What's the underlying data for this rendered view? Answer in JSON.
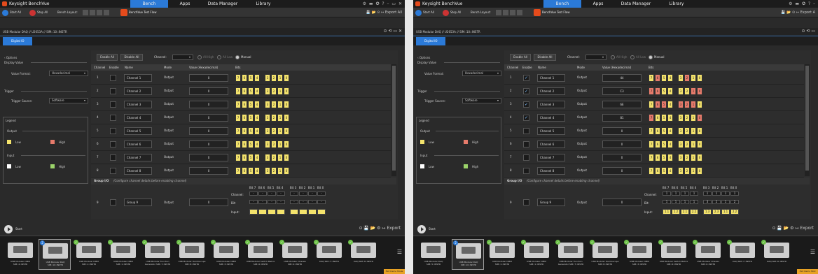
{
  "panels": [
    {
      "app_title": "Keysight BenchVue",
      "menus": [
        "Bench",
        "Apps",
        "Data Manager",
        "Library"
      ],
      "title_icons": "⚙ ▬ ✪ ? – ▭ ✕",
      "toolbar": {
        "start_all": "Start All",
        "stop_all": "Stop All",
        "bench_layout": "Bench Layout:",
        "test_flow": "BenchVue Test Flow",
        "right": "💾 📂 ⊙ ↦ Export All"
      },
      "breadcrumb": "USB Modular DAQ // U2653A // SIM::10::INSTR",
      "inst_icons": "⊙ ⟲ ▭ ✕",
      "tab_label": "Digital IO",
      "sidebar": {
        "options": "‹ Options",
        "display_value": "Display Value",
        "value_format_label": "Value Format:",
        "value_format": "Hexadecimal",
        "trigger": "Trigger",
        "trigger_source_label": "Trigger Source:",
        "trigger_source": "Software",
        "legend": "Legend",
        "output": "Output",
        "input": "Input",
        "low": "Low",
        "high": "High"
      },
      "controls": {
        "enable_all": "Enable All",
        "disable_all": "Disable All",
        "channel": "Channel:",
        "all_high": "All High",
        "all_low": "All Low",
        "manual": "Manual"
      },
      "headers": [
        "Channel",
        "Enable",
        "Name",
        "Mode",
        "Value (Hexadecimal)",
        "Bits"
      ],
      "rows": [
        {
          "num": "1",
          "enabled": "",
          "name": "Channel 1",
          "mode": "Output",
          "value": "0",
          "high": [
            0,
            0,
            0,
            0,
            0,
            0,
            0,
            0
          ]
        },
        {
          "num": "2",
          "enabled": "",
          "name": "Channel 2",
          "mode": "Output",
          "value": "0",
          "high": [
            0,
            0,
            0,
            0,
            0,
            0,
            0,
            0
          ]
        },
        {
          "num": "3",
          "enabled": "",
          "name": "Channel 3",
          "mode": "Output",
          "value": "0",
          "high": [
            0,
            0,
            0,
            0,
            0,
            0,
            0,
            0
          ]
        },
        {
          "num": "4",
          "enabled": "",
          "name": "Channel 4",
          "mode": "Output",
          "value": "0",
          "high": [
            0,
            0,
            0,
            0,
            0,
            0,
            0,
            0
          ]
        },
        {
          "num": "5",
          "enabled": "",
          "name": "Channel 5",
          "mode": "Output",
          "value": "0",
          "high": [
            0,
            0,
            0,
            0,
            0,
            0,
            0,
            0
          ]
        },
        {
          "num": "6",
          "enabled": "",
          "name": "Channel 6",
          "mode": "Output",
          "value": "0",
          "high": [
            0,
            0,
            0,
            0,
            0,
            0,
            0,
            0
          ]
        },
        {
          "num": "7",
          "enabled": "",
          "name": "Channel 7",
          "mode": "Output",
          "value": "0",
          "high": [
            0,
            0,
            0,
            0,
            0,
            0,
            0,
            0
          ]
        },
        {
          "num": "8",
          "enabled": "",
          "name": "Channel 8",
          "mode": "Output",
          "value": "0",
          "high": [
            0,
            0,
            0,
            0,
            0,
            0,
            0,
            0
          ]
        }
      ],
      "bit_digits": [
        "7",
        "6",
        "5",
        "4",
        "3",
        "2",
        "1",
        "0"
      ],
      "group": {
        "title": "Group I/O",
        "note": "(Configure channel details before enabling channel)",
        "bit_labels": [
          "Bit 7",
          "Bit 6",
          "Bit 5",
          "Bit 4",
          "Bit 3",
          "Bit 2",
          "Bit 1",
          "Bit 0"
        ],
        "row_num": "9",
        "name": "Group 9",
        "mode": "Output",
        "value": "0",
        "channel_label": "Channel:",
        "bit_label": "Bit:",
        "input_label": "Input:",
        "channel_vals": [
          "-",
          "-",
          "-",
          "-",
          "-",
          "-",
          "-",
          "-"
        ],
        "bit_vals": [
          "-",
          "-",
          "-",
          "-",
          "-",
          "-",
          "-",
          "-"
        ],
        "input_vals": [
          "",
          "",
          "",
          "",
          "",
          "",
          "",
          ""
        ]
      },
      "start": "Start",
      "start_icons": "⊙ 💾 📂 ⚙ ↦ Export",
      "devices": [
        {
          "label": "USB Modular DMM SIM::4::INSTR",
          "badge": ""
        },
        {
          "label": "USB Modular DAQ SIM::10::INSTR",
          "badge": "2"
        },
        {
          "label": "USB Modular DMM SIM::1::INSTR",
          "badge": "✓"
        },
        {
          "label": "USB Modular DMM SIM::1::INSTR",
          "badge": "✓"
        },
        {
          "label": "USB Modular Function Generator SIM::7::INSTR",
          "badge": "✓"
        },
        {
          "label": "USB Modular Oscilloscope SIM::8::INSTR",
          "badge": "✓"
        },
        {
          "label": "USB Modular DMM SIM::3::INSTR",
          "badge": "✓"
        },
        {
          "label": "USB Modular Switch Matrix SIM::6::INSTR",
          "badge": "✓"
        },
        {
          "label": "USB Modular Chassis SIM::0::INSTR",
          "badge": "✓"
        },
        {
          "label": "DAQ SIM::7::INSTR",
          "badge": "✓"
        },
        {
          "label": "DAQ SIM::8::INSTR",
          "badge": "✓"
        }
      ],
      "exit": "Exit Demo Mode"
    },
    {
      "app_title": "Keysight BenchVue",
      "menus": [
        "Bench",
        "Apps",
        "Data Manager",
        "Library"
      ],
      "title_icons": "⚙ ▬ ✪ ? –",
      "toolbar": {
        "start_all": "Start All",
        "stop_all": "Stop All",
        "bench_layout": "Bench Layout:",
        "test_flow": "BenchVue Test Flow",
        "right": "💾 📂 ⊙ ↦ Export A"
      },
      "breadcrumb": "USB Modular DAQ // U2653A // SIM::10::INSTR",
      "inst_icons": "⊙ ⟲ ▭",
      "tab_label": "Digital IO",
      "sidebar": {
        "options": "‹ Options",
        "display_value": "Display Value",
        "value_format_label": "Value Format:",
        "value_format": "Hexadecimal",
        "trigger": "Trigger",
        "trigger_source_label": "Trigger Source:",
        "trigger_source": "Software",
        "legend": "Legend",
        "output": "Output",
        "input": "Input",
        "low": "Low",
        "high": "High"
      },
      "controls": {
        "enable_all": "Enable All",
        "disable_all": "Disable All",
        "channel": "Channel:",
        "all_high": "All High",
        "all_low": "All Low",
        "manual": "Manual"
      },
      "headers": [
        "Channel",
        "Enable",
        "Name",
        "Mode",
        "Value (Hexadecimal)",
        "Bits"
      ],
      "rows": [
        {
          "num": "1",
          "enabled": "✓",
          "name": "Channel 1",
          "mode": "Output",
          "value": "44",
          "high": [
            0,
            1,
            0,
            0,
            0,
            1,
            0,
            0
          ]
        },
        {
          "num": "2",
          "enabled": "✓",
          "name": "Channel 2",
          "mode": "Output",
          "value": "C3",
          "high": [
            1,
            1,
            0,
            0,
            0,
            0,
            1,
            1
          ]
        },
        {
          "num": "3",
          "enabled": "✓",
          "name": "Channel 3",
          "mode": "Output",
          "value": "6E",
          "high": [
            0,
            1,
            1,
            0,
            1,
            1,
            1,
            0
          ]
        },
        {
          "num": "4",
          "enabled": "✓",
          "name": "Channel 4",
          "mode": "Output",
          "value": "81",
          "high": [
            1,
            0,
            0,
            0,
            0,
            0,
            0,
            1
          ]
        },
        {
          "num": "5",
          "enabled": "",
          "name": "Channel 5",
          "mode": "Output",
          "value": "0",
          "high": [
            0,
            0,
            0,
            0,
            0,
            0,
            0,
            0
          ]
        },
        {
          "num": "6",
          "enabled": "",
          "name": "Channel 6",
          "mode": "Output",
          "value": "0",
          "high": [
            0,
            0,
            0,
            0,
            0,
            0,
            0,
            0
          ]
        },
        {
          "num": "7",
          "enabled": "",
          "name": "Channel 7",
          "mode": "Output",
          "value": "0",
          "high": [
            0,
            0,
            0,
            0,
            0,
            0,
            0,
            0
          ]
        },
        {
          "num": "8",
          "enabled": "",
          "name": "Channel 8",
          "mode": "Output",
          "value": "0",
          "high": [
            0,
            0,
            0,
            0,
            0,
            0,
            0,
            0
          ]
        }
      ],
      "bit_digits": [
        "7",
        "6",
        "5",
        "4",
        "3",
        "2",
        "1",
        "0"
      ],
      "group": {
        "title": "Group I/O",
        "note": "(Configure channel details before enabling channel)",
        "bit_labels": [
          "Bit 7",
          "Bit 6",
          "Bit 5",
          "Bit 4",
          "Bit 3",
          "Bit 2",
          "Bit 1",
          "Bit 0"
        ],
        "row_num": "9",
        "name": "Group 9",
        "mode": "Output",
        "value": "0",
        "channel_label": "Channel:",
        "bit_label": "Bit:",
        "input_label": "Input:",
        "channel_vals": [
          "1",
          "1",
          "1",
          "1",
          "1",
          "1",
          "1",
          "1"
        ],
        "bit_vals": [
          "1",
          "1",
          "1",
          "1",
          "3",
          "2",
          "1",
          "2"
        ],
        "input_vals": [
          "1.1",
          "1.2",
          "2.1",
          "2.2",
          "1.3",
          "2.3",
          "1.1",
          "2.2"
        ]
      },
      "start": "Start",
      "start_icons": "⊙ 💾 📂 ⚙ ↦ Export",
      "devices": [
        {
          "label": "USB Modular DAQ SIM::5::INSTR",
          "badge": ""
        },
        {
          "label": "USB Modular DAQ SIM::10::INSTR",
          "badge": "2"
        },
        {
          "label": "USB Modular DMM SIM::1::INSTR",
          "badge": "✓"
        },
        {
          "label": "USB Modular DMM SIM::1::INSTR",
          "badge": "✓"
        },
        {
          "label": "USB Modular Function Generator SIM::7::INSTR",
          "badge": "✓"
        },
        {
          "label": "USB Modular Oscilloscope SIM::8::INSTR",
          "badge": "✓"
        },
        {
          "label": "USB Modular DMM SIM::3::INSTR",
          "badge": "✓"
        },
        {
          "label": "USB Modular Switch Matrix SIM::6::INSTR",
          "badge": "✓"
        },
        {
          "label": "USB Modular Chassis SIM::0::INSTR",
          "badge": "✓"
        },
        {
          "label": "DAQ SIM::7::INSTR",
          "badge": "✓"
        },
        {
          "label": "DAQ SIM::8::INSTR",
          "badge": "✓"
        }
      ],
      "exit": "Exit Demo Mod"
    }
  ],
  "colors": {
    "bench_tab": "#2b7ad8",
    "bit_low": "#f4e36c",
    "bit_high": "#e77b6b",
    "input_low": "#ffffff",
    "input_high": "#9bd36a",
    "accent_orange": "#e54b1c"
  }
}
